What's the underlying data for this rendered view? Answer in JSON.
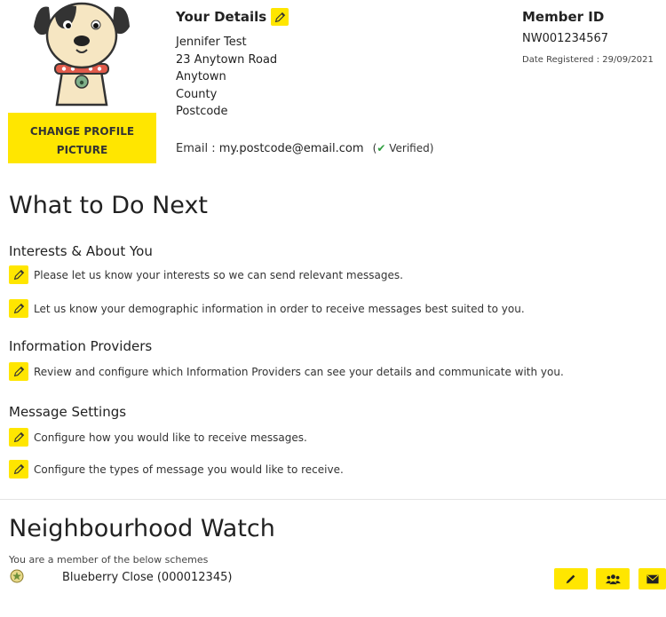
{
  "profile": {
    "change_picture_label": "CHANGE PROFILE PICTURE"
  },
  "details": {
    "title": "Your Details",
    "name": "Jennifer Test",
    "address_line1": "23 Anytown Road",
    "town": "Anytown",
    "county": "County",
    "postcode": "Postcode",
    "email_label": "Email : ",
    "email": "my.postcode@email.com",
    "verified_label": "Verified"
  },
  "member": {
    "title": "Member ID",
    "id": "NW001234567",
    "date_registered": "Date Registered : 29/09/2021"
  },
  "next": {
    "title": "What to Do Next",
    "sections": [
      {
        "heading": "Interests & About You",
        "items": [
          "Please let us know your interests so we can send relevant messages.",
          "Let us know your demographic information in order to receive messages best suited to you."
        ]
      },
      {
        "heading": "Information Providers",
        "items": [
          "Review and configure which Information Providers can see your details and communicate with you."
        ]
      },
      {
        "heading": "Message Settings",
        "items": [
          "Configure how you would like to receive messages.",
          "Configure the types of message you would like to receive."
        ]
      }
    ]
  },
  "watch": {
    "title": "Neighbourhood Watch",
    "subtitle": "You are a member of the below schemes",
    "schemes": [
      {
        "name": "Blueberry Close (000012345)"
      }
    ]
  },
  "colors": {
    "accent": "#ffe600",
    "verified": "#2e9e3e"
  },
  "icons": [
    "pencil-icon",
    "people-icon",
    "envelope-icon",
    "check-icon",
    "scheme-badge-icon"
  ]
}
